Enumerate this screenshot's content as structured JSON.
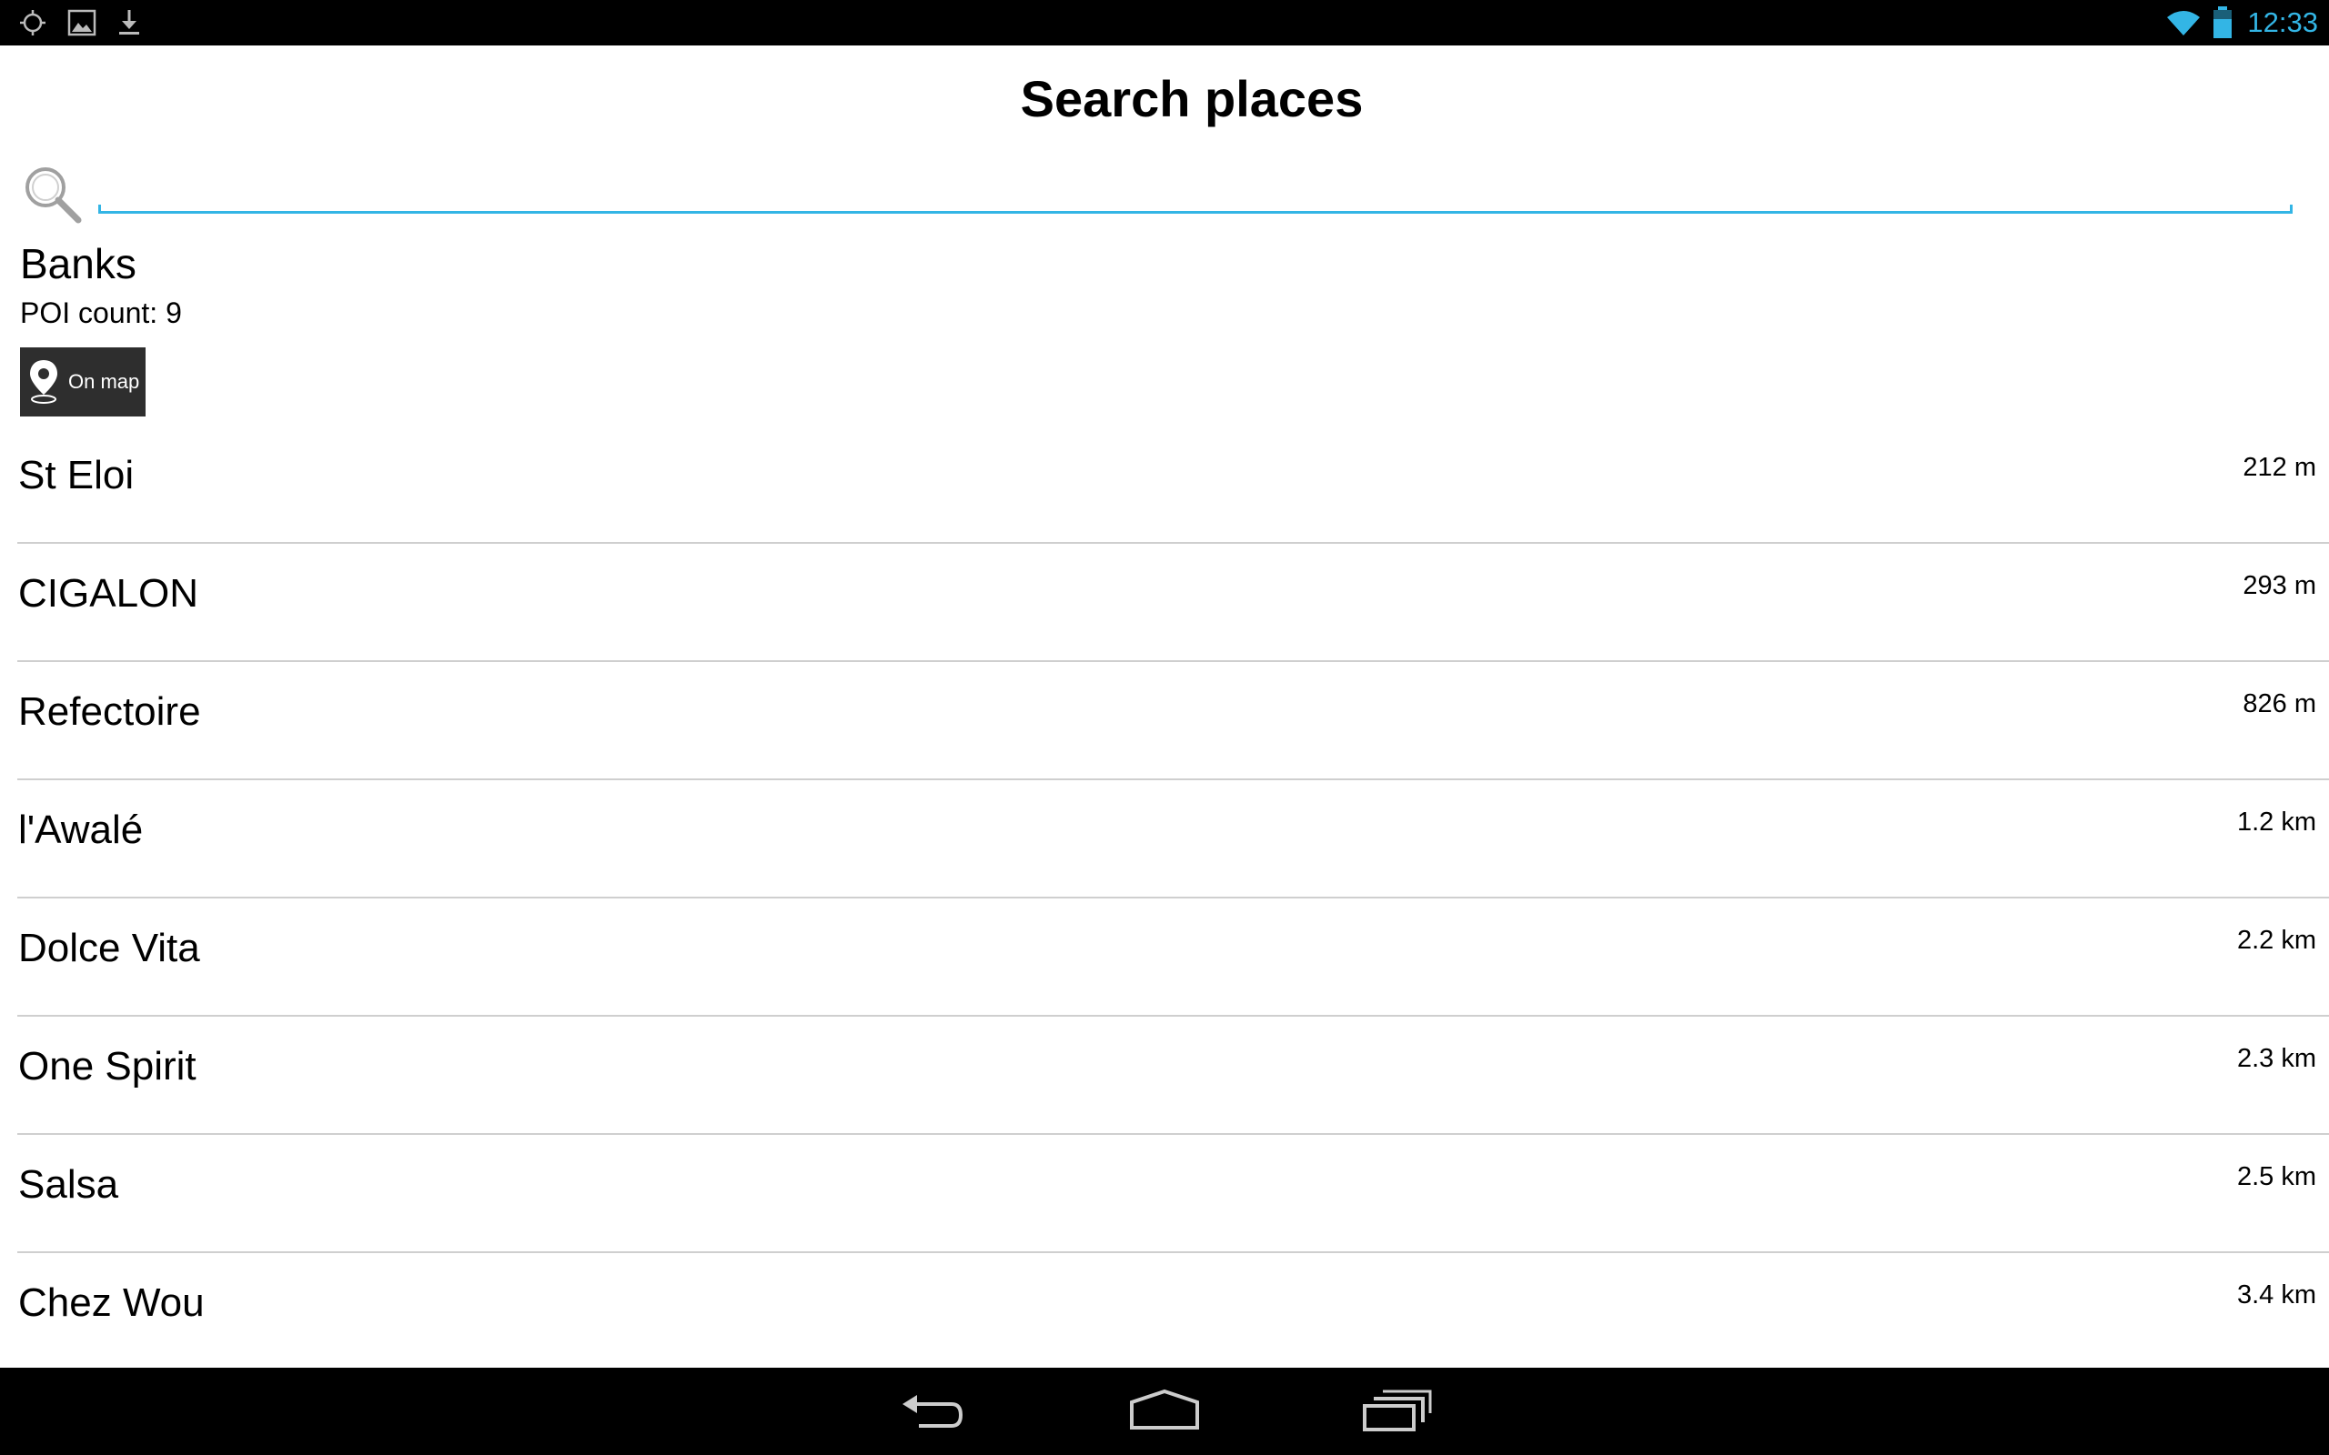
{
  "status_bar": {
    "left_icons": [
      "crosshair-icon",
      "image-icon",
      "download-icon"
    ],
    "right_icons": [
      "wifi-icon",
      "battery-icon"
    ],
    "time": "12:33",
    "accent_color": "#33b5e5"
  },
  "header": {
    "title": "Search places"
  },
  "search": {
    "icon": "search-icon",
    "value": "",
    "placeholder": ""
  },
  "category": {
    "name": "Banks",
    "poi_count_label": "POI count: 9",
    "on_map_button": {
      "icon": "map-pin-icon",
      "label": "On map"
    }
  },
  "results": [
    {
      "name": "St Eloi",
      "distance": "212 m"
    },
    {
      "name": "CIGALON",
      "distance": "293 m"
    },
    {
      "name": "Refectoire",
      "distance": "826 m"
    },
    {
      "name": "l'Awalé",
      "distance": "1.2 km"
    },
    {
      "name": "Dolce Vita",
      "distance": "2.2 km"
    },
    {
      "name": "One Spirit",
      "distance": "2.3 km"
    },
    {
      "name": "Salsa",
      "distance": "2.5 km"
    },
    {
      "name": "Chez Wou",
      "distance": "3.4 km"
    }
  ],
  "nav_bar": {
    "buttons": [
      "back-icon",
      "home-icon",
      "recent-apps-icon"
    ]
  }
}
